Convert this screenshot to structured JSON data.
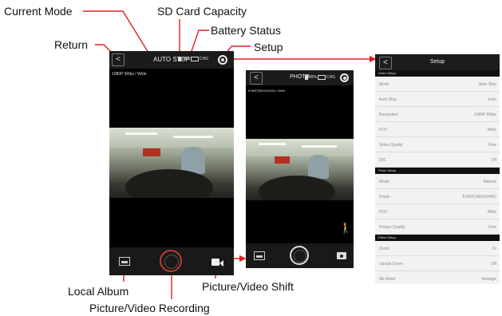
{
  "callouts": {
    "current_mode": "Current Mode",
    "sd_card_capacity": "SD Card Capacity",
    "battery_status": "Battery Status",
    "return": "Return",
    "setup": "Setup",
    "local_album": "Local Album",
    "picture_video_recording": "Picture/Video Recording",
    "picture_video_shift": "Picture/Video Shift"
  },
  "video_screen": {
    "back_glyph": "<",
    "mode": "AUTO STOP",
    "sd": "99%",
    "battery": "CHG",
    "resolution": "1080P 60fps / Wide"
  },
  "photo_screen": {
    "back_glyph": "<",
    "mode": "PHOTO",
    "sd": "99%",
    "battery": "CHG",
    "resolution": "8.5MP(3600x2400) / Wide"
  },
  "settings": {
    "back_glyph": "<",
    "title": "Setup",
    "sections": [
      {
        "title": "Video Setup",
        "rows": [
          {
            "key": "Mode",
            "value": "Auto Stop"
          },
          {
            "key": "Auto Stop",
            "value": "1min"
          },
          {
            "key": "Resolution",
            "value": "1080P 60fps"
          },
          {
            "key": "FOV",
            "value": "Wide"
          },
          {
            "key": "Video Quality",
            "value": "Fine"
          },
          {
            "key": "DIS",
            "value": "Off"
          }
        ]
      },
      {
        "title": "Photo Setup",
        "rows": [
          {
            "key": "Mode",
            "value": "Manual"
          },
          {
            "key": "Pixels",
            "value": "8.5MP(3600x2400)"
          },
          {
            "key": "FOV",
            "value": "Wide"
          },
          {
            "key": "Picture Quality",
            "value": "Fine"
          }
        ]
      },
      {
        "title": "Effect Setup",
        "rows": [
          {
            "key": "Zoom",
            "value": "2x"
          },
          {
            "key": "Upside Down",
            "value": "Off"
          },
          {
            "key": "AE Meter",
            "value": "Average"
          }
        ]
      }
    ]
  },
  "colors": {
    "record_ring": "#c0392b",
    "screen_bg": "#000000",
    "settings_bg": "#f2f2f2",
    "arrow": "#e02020"
  }
}
